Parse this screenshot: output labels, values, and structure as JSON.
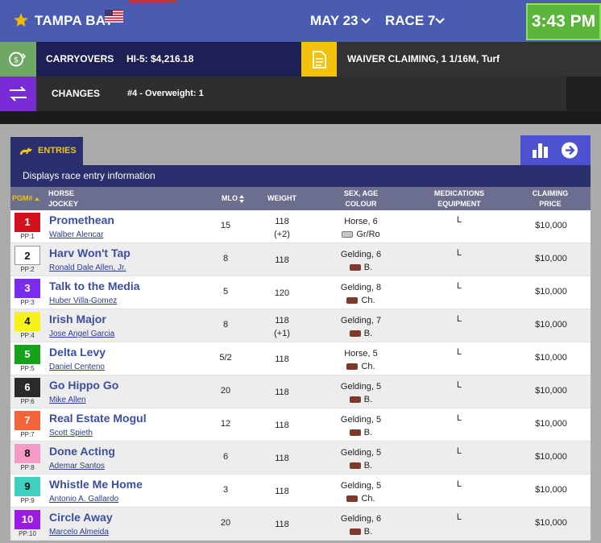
{
  "header": {
    "track": "TAMPA BAY",
    "date": "MAY 23",
    "race": "RACE 7",
    "clock": "3:43 PM"
  },
  "carryovers": {
    "label": "CARRYOVERS",
    "value": "HI-5: $4,216.18"
  },
  "race_info": "WAIVER CLAIMING, 1 1/16M, Turf",
  "changes": {
    "label": "CHANGES",
    "value": "#4 - Overweight: 1"
  },
  "tabs": {
    "entries": "ENTRIES"
  },
  "description": "Displays race entry information",
  "columns": {
    "pgm": "PGM#",
    "horse": "HORSE",
    "jockey": "JOCKEY",
    "mlo": "MLO",
    "weight": "WEIGHT",
    "sex": "SEX, AGE",
    "colour": "COLOUR",
    "medications": "MEDICATIONS",
    "equipment": "EQUIPMENT",
    "claiming": "CLAIMING",
    "price": "PRICE"
  },
  "colors": {
    "header_bg": "#4a5bb2",
    "clock_bg": "#5ab53a",
    "accent_yellow": "#f1c40f",
    "horse_link": "#3b4ea0"
  },
  "entries": [
    {
      "pgm": "1",
      "pp": "PP:1",
      "color": "#d2111d",
      "text_color": "#ffffff",
      "horse": "Promethean",
      "jockey": "Walber Alencar",
      "mlo": "15",
      "weight": "118",
      "weight_adj": "(+2)",
      "sex_age": "Horse, 6",
      "coat": "Gr/Ro",
      "coat_color": "#c8c8c8",
      "med": "L",
      "claim": "$10,000"
    },
    {
      "pgm": "2",
      "pp": "PP:2",
      "color": "#ffffff",
      "text_color": "#111111",
      "horse": "Harv Won't Tap",
      "jockey": "Ronald Dale Allen, Jr.",
      "mlo": "8",
      "weight": "118",
      "weight_adj": "",
      "sex_age": "Gelding, 6",
      "coat": "B.",
      "coat_color": "#7b3a2a",
      "med": "L",
      "claim": "$10,000"
    },
    {
      "pgm": "3",
      "pp": "PP:3",
      "color": "#7b2cf0",
      "text_color": "#ffffff",
      "horse": "Talk to the Media",
      "jockey": "Huber Villa-Gomez",
      "mlo": "5",
      "weight": "120",
      "weight_adj": "",
      "sex_age": "Gelding, 8",
      "coat": "Ch.",
      "coat_color": "#7b3a2a",
      "med": "L",
      "claim": "$10,000"
    },
    {
      "pgm": "4",
      "pp": "PP:4",
      "color": "#f7f21a",
      "text_color": "#111111",
      "horse": "Irish Major",
      "jockey": "Jose Angel Garcia",
      "mlo": "8",
      "weight": "118",
      "weight_adj": "(+1)",
      "sex_age": "Gelding, 7",
      "coat": "B.",
      "coat_color": "#7b3a2a",
      "med": "L",
      "claim": "$10,000"
    },
    {
      "pgm": "5",
      "pp": "PP:5",
      "color": "#16a21a",
      "text_color": "#ffffff",
      "horse": "Delta Levy",
      "jockey": "Daniel Centeno",
      "mlo": "5/2",
      "weight": "118",
      "weight_adj": "",
      "sex_age": "Horse, 5",
      "coat": "Ch.",
      "coat_color": "#7b3a2a",
      "med": "L",
      "claim": "$10,000"
    },
    {
      "pgm": "6",
      "pp": "PP:6",
      "color": "#2a2a2a",
      "text_color": "#ffffff",
      "horse": "Go Hippo Go",
      "jockey": "Mike Allen",
      "mlo": "20",
      "weight": "118",
      "weight_adj": "",
      "sex_age": "Gelding, 5",
      "coat": "B.",
      "coat_color": "#7b3a2a",
      "med": "L",
      "claim": "$10,000"
    },
    {
      "pgm": "7",
      "pp": "PP:7",
      "color": "#f2643a",
      "text_color": "#ffffff",
      "horse": "Real Estate Mogul",
      "jockey": "Scott Spieth",
      "mlo": "12",
      "weight": "118",
      "weight_adj": "",
      "sex_age": "Gelding, 5",
      "coat": "B.",
      "coat_color": "#7b3a2a",
      "med": "L",
      "claim": "$10,000"
    },
    {
      "pgm": "8",
      "pp": "PP:8",
      "color": "#f89ac8",
      "text_color": "#111111",
      "horse": "Done Acting",
      "jockey": "Ademar Santos",
      "mlo": "6",
      "weight": "118",
      "weight_adj": "",
      "sex_age": "Gelding, 5",
      "coat": "B.",
      "coat_color": "#7b3a2a",
      "med": "L",
      "claim": "$10,000"
    },
    {
      "pgm": "9",
      "pp": "PP:9",
      "color": "#3fd0c0",
      "text_color": "#111111",
      "horse": "Whistle Me Home",
      "jockey": "Antonio A. Gallardo",
      "mlo": "3",
      "weight": "118",
      "weight_adj": "",
      "sex_age": "Gelding, 5",
      "coat": "Ch.",
      "coat_color": "#7b3a2a",
      "med": "L",
      "claim": "$10,000"
    },
    {
      "pgm": "10",
      "pp": "PP:10",
      "color": "#9b1ce0",
      "text_color": "#ffffff",
      "horse": "Circle Away",
      "jockey": "Marcelo Almeida",
      "mlo": "20",
      "weight": "118",
      "weight_adj": "",
      "sex_age": "Gelding, 6",
      "coat": "B.",
      "coat_color": "#7b3a2a",
      "med": "L",
      "claim": "$10,000"
    }
  ]
}
